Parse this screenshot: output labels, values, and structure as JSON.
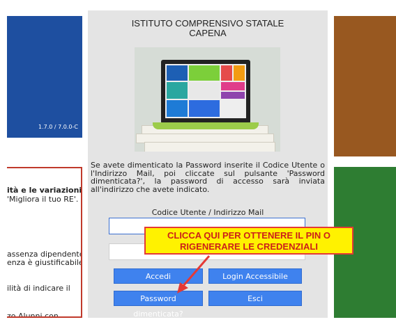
{
  "left_panel": {
    "version": "1.7.0 / 7.0.0-C",
    "lines": [
      "ità e le variazioni",
      "'Migliora il tuo RE'.",
      "assenza dipendente",
      "enza è giustificabile",
      "ilità di indicare il",
      "zo Alunni  con"
    ]
  },
  "header": {
    "title_line1": "ISTITUTO COMPRENSIVO STATALE",
    "title_line2": "CAPENA"
  },
  "info": {
    "text": "Se avete dimenticato la Password inserite il Codice Utente o l'Indirizzo Mail, poi cliccate sul pulsante 'Password dimenticata?', la password di accesso sarà inviata all'indirizzo che avete indicato."
  },
  "form": {
    "user_label": "Codice Utente / Indirizzo Mail",
    "user_value": "",
    "pass_value": ""
  },
  "buttons": {
    "accedi": "Accedi",
    "login_accessibile": "Login Accessibile",
    "password_dimenticata": "Password dimenticata?",
    "esci": "Esci"
  },
  "callout": {
    "line1": "CLICCA QUI PER OTTENERE IL PIN O",
    "line2": "RIGENERARE LE CREDENZIALI"
  },
  "colors": {
    "blue_panel": "#1e4fa0",
    "brown_panel": "#985820",
    "green_panel": "#2e7d32",
    "button": "#3f82ee",
    "callout_bg": "#fff200",
    "callout_text": "#cc1f1a"
  }
}
